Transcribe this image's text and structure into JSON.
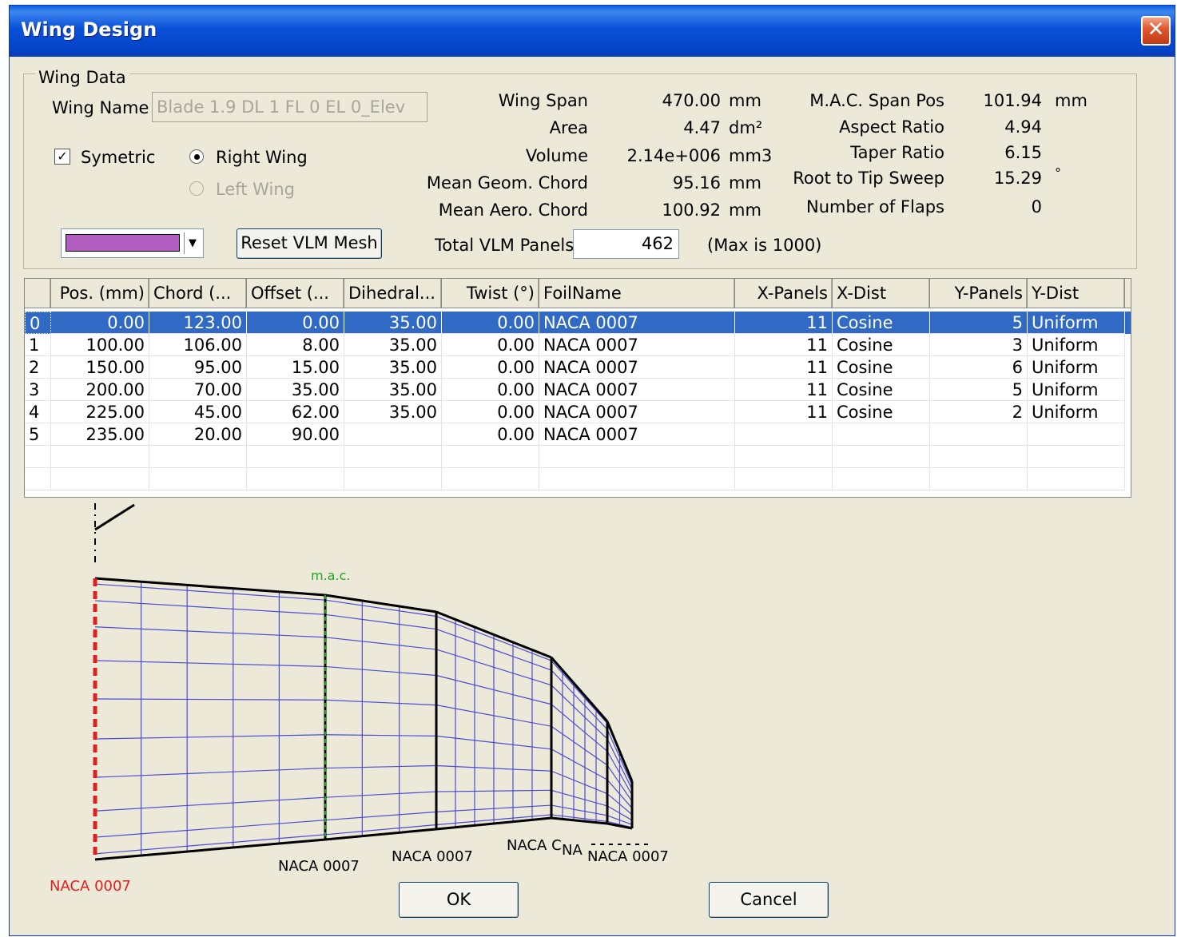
{
  "window": {
    "title": "Wing Design",
    "close": "✕"
  },
  "wing_data": {
    "group_label": "Wing Data",
    "name_label": "Wing Name",
    "name_value": "Blade 1.9 DL 1 FL 0 EL 0_Elev",
    "symetric_label": "Symetric",
    "symetric_checked": true,
    "right_wing_label": "Right Wing",
    "left_wing_label": "Left Wing",
    "selected_side": "Right Wing",
    "wing_color": "#b05fc0",
    "reset_label": "Reset VLM Mesh",
    "total_panels_label": "Total VLM Panels",
    "total_panels_value": "462",
    "max_label": "(Max is 1000)"
  },
  "stats": {
    "wing_span": {
      "label": "Wing Span",
      "value": "470.00",
      "unit": "mm"
    },
    "area": {
      "label": "Area",
      "value": "4.47",
      "unit": "dm²"
    },
    "volume": {
      "label": "Volume",
      "value": "2.14e+006",
      "unit": "mm3"
    },
    "mean_geom_chord": {
      "label": "Mean Geom. Chord",
      "value": "95.16",
      "unit": "mm"
    },
    "mean_aero_chord": {
      "label": "Mean Aero. Chord",
      "value": "100.92",
      "unit": "mm"
    },
    "mac_span_pos": {
      "label": "M.A.C. Span Pos",
      "value": "101.94",
      "unit": "mm"
    },
    "aspect_ratio": {
      "label": "Aspect Ratio",
      "value": "4.94",
      "unit": ""
    },
    "taper_ratio": {
      "label": "Taper Ratio",
      "value": "6.15",
      "unit": ""
    },
    "root_tip_sweep": {
      "label": "Root to Tip Sweep",
      "value": "15.29",
      "unit": "°"
    },
    "num_flaps": {
      "label": "Number of Flaps",
      "value": "0",
      "unit": ""
    }
  },
  "table": {
    "headers": [
      "",
      "Pos. (mm)",
      "Chord (...",
      "Offset (...",
      "Dihedral...",
      "Twist (°)",
      "FoilName",
      "X-Panels",
      "X-Dist",
      "Y-Panels",
      "Y-Dist"
    ],
    "rows": [
      [
        "0",
        "0.00",
        "123.00",
        "0.00",
        "35.00",
        "0.00",
        "NACA 0007",
        "11",
        "Cosine",
        "5",
        "Uniform"
      ],
      [
        "1",
        "100.00",
        "106.00",
        "8.00",
        "35.00",
        "0.00",
        "NACA 0007",
        "11",
        "Cosine",
        "3",
        "Uniform"
      ],
      [
        "2",
        "150.00",
        "95.00",
        "15.00",
        "35.00",
        "0.00",
        "NACA 0007",
        "11",
        "Cosine",
        "6",
        "Uniform"
      ],
      [
        "3",
        "200.00",
        "70.00",
        "35.00",
        "35.00",
        "0.00",
        "NACA 0007",
        "11",
        "Cosine",
        "5",
        "Uniform"
      ],
      [
        "4",
        "225.00",
        "45.00",
        "62.00",
        "35.00",
        "0.00",
        "NACA 0007",
        "11",
        "Cosine",
        "2",
        "Uniform"
      ],
      [
        "5",
        "235.00",
        "20.00",
        "90.00",
        "",
        "0.00",
        "NACA 0007",
        "",
        "",
        "",
        ""
      ]
    ],
    "selected_row": 0
  },
  "planform": {
    "mac_label": "m.a.c.",
    "root_foil": "NACA 0007",
    "foil_1": "NACA 0007",
    "foil_2": "NACA 0007",
    "foil_3": "NACA C",
    "foil_4": "NA",
    "foil_5": "NACA 0007",
    "mesh_color": "#4b4bd6",
    "outline_color": "#000000",
    "root_color": "#e02020",
    "mac_color": "#21a621"
  },
  "buttons": {
    "ok": "OK",
    "cancel": "Cancel"
  }
}
